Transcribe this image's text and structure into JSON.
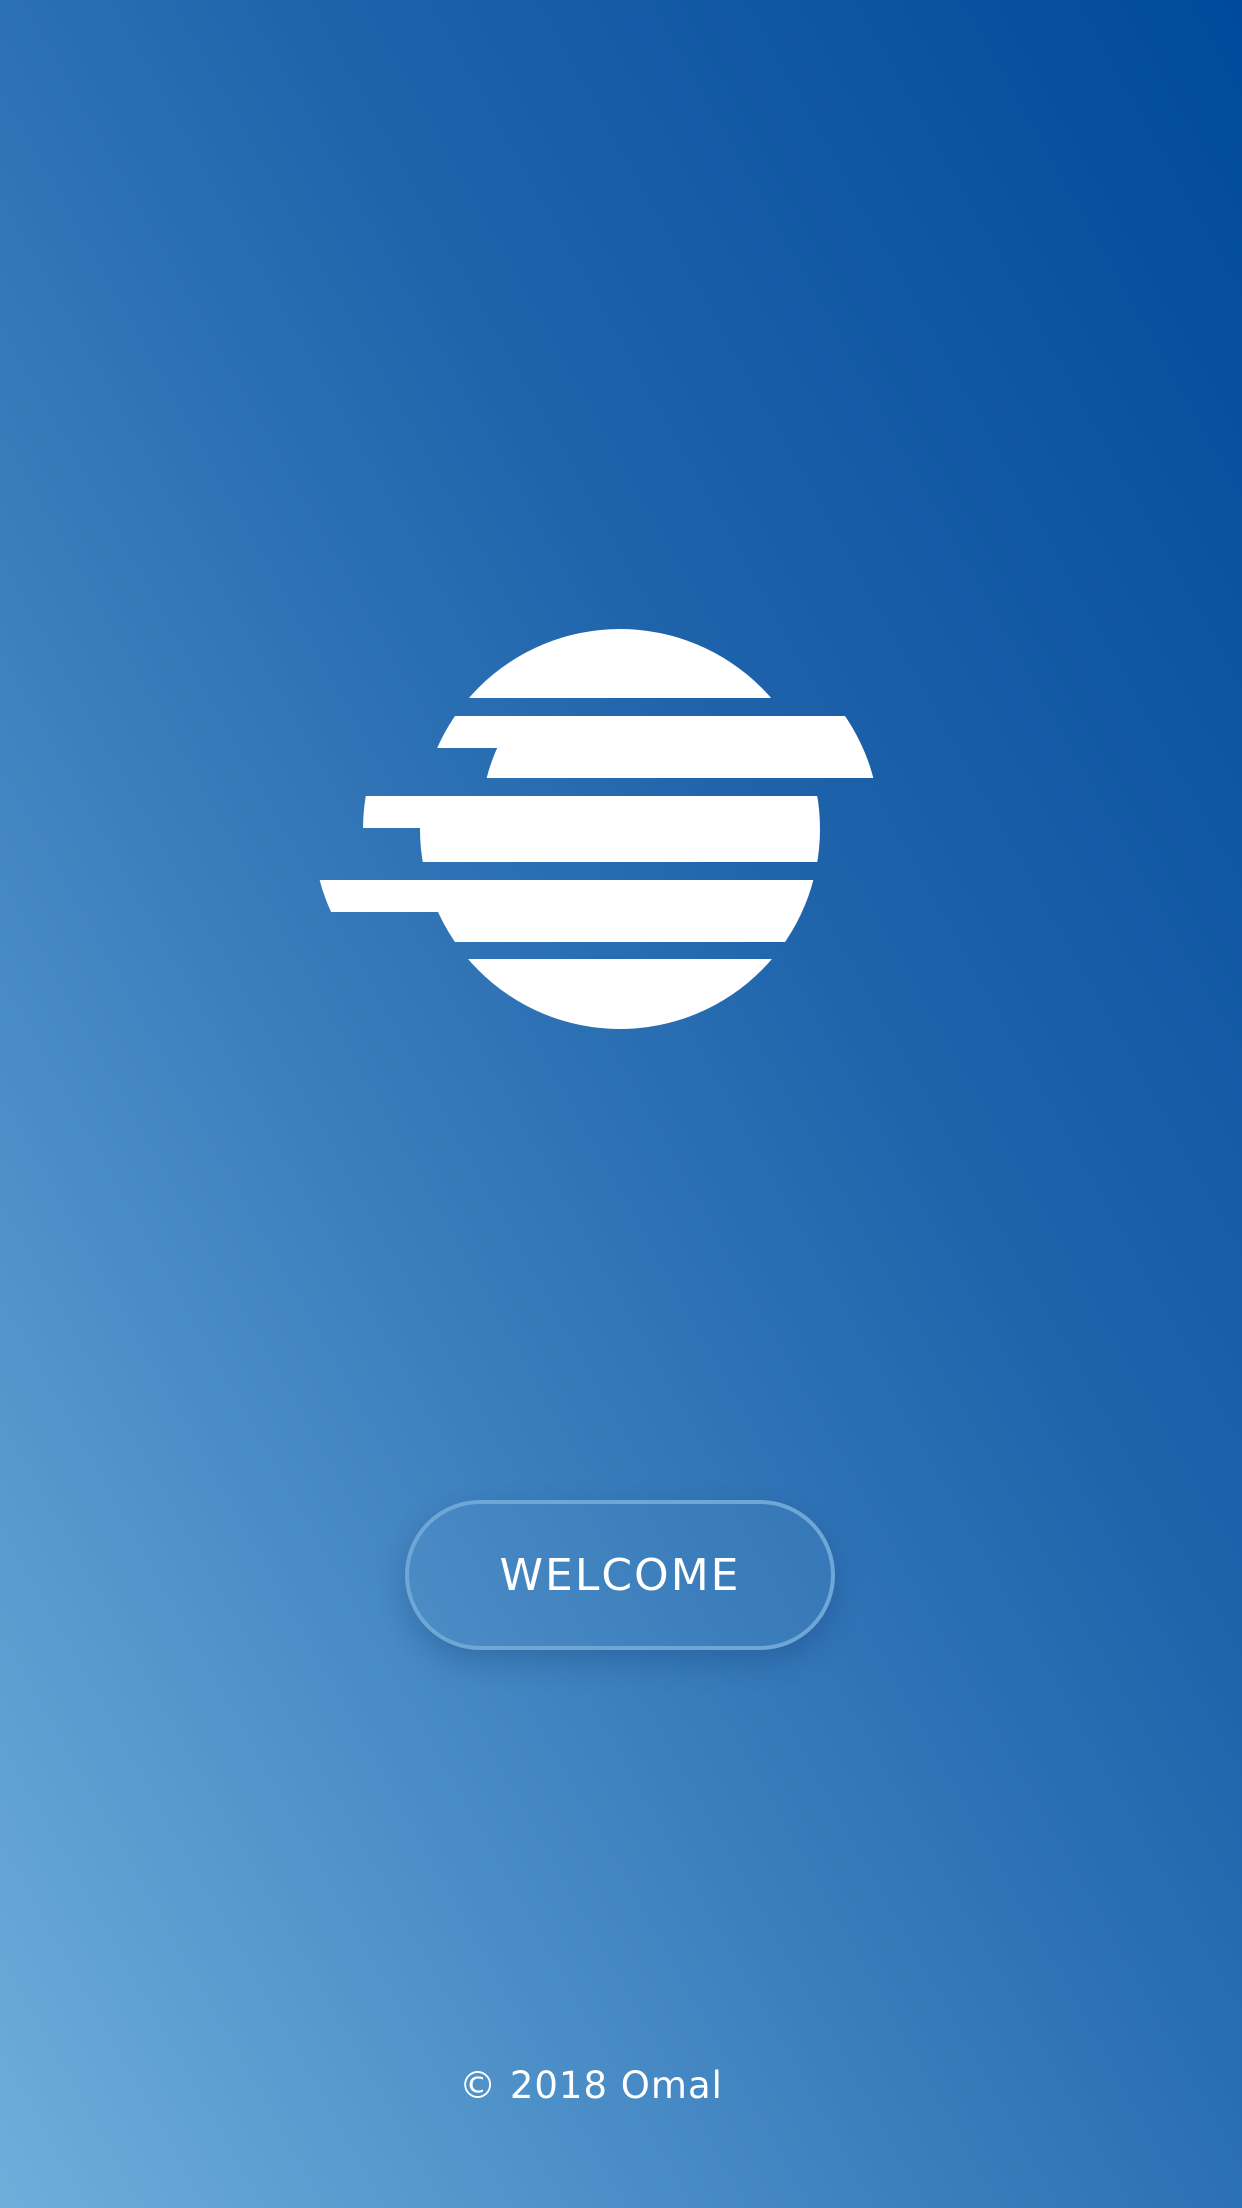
{
  "logo": {
    "icon": "striped-sun-logo-icon",
    "color": "#ffffff"
  },
  "welcome_button": {
    "label": "WELCOME",
    "border_color": "#6ea7d6"
  },
  "footer": {
    "copyright": "© 2018 Omal"
  },
  "colors": {
    "background_top_right": "#004a9b",
    "background_bottom_left": "#6eaedb",
    "text": "#ffffff"
  }
}
